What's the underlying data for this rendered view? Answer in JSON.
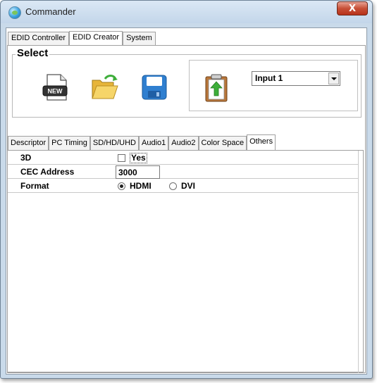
{
  "window": {
    "title": "Commander",
    "close_label": "X"
  },
  "main_tabs": [
    {
      "label": "EDID Controller",
      "active": false
    },
    {
      "label": "EDID Creator",
      "active": true
    },
    {
      "label": "System",
      "active": false
    }
  ],
  "select_group": {
    "title": "Select",
    "new_icon_text": "NEW",
    "input_select": {
      "value": "Input 1"
    }
  },
  "sub_tabs": [
    {
      "label": "Descriptor",
      "active": false
    },
    {
      "label": "PC Timing",
      "active": false
    },
    {
      "label": "SD/HD/UHD",
      "active": false
    },
    {
      "label": "Audio1",
      "active": false
    },
    {
      "label": "Audio2",
      "active": false
    },
    {
      "label": "Color Space",
      "active": false
    },
    {
      "label": "Others",
      "active": true
    }
  ],
  "others": {
    "rows": [
      {
        "label": "3D"
      },
      {
        "label": "CEC Address"
      },
      {
        "label": "Format"
      }
    ],
    "three_d": {
      "checkbox_label": "Yes",
      "checked": false
    },
    "cec_address": {
      "value": "3000"
    },
    "format": {
      "options": [
        "HDMI",
        "DVI"
      ],
      "selected": "HDMI"
    }
  },
  "colors": {
    "window_frame": "#c9daea",
    "close_button": "#c75037",
    "save_icon": "#2f7fd0",
    "folder_icon": "#f2c94c",
    "arrow_green": "#3dae3a"
  }
}
